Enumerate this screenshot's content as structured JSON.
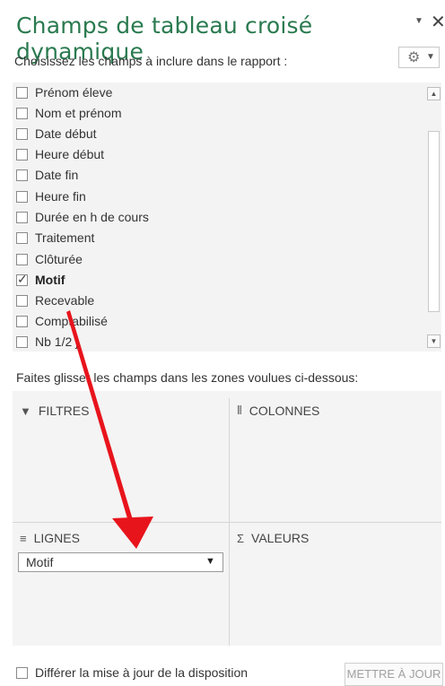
{
  "pane": {
    "title": "Champs de tableau croisé dynamique",
    "menu_icon": "chevron-down-icon",
    "close_icon": "close-icon",
    "subtitle": "Choisissez les champs à inclure dans le rapport :",
    "gear_icon": "gear-icon"
  },
  "fields": [
    {
      "label": "Prénom éleve",
      "checked": false
    },
    {
      "label": "Nom et prénom",
      "checked": false
    },
    {
      "label": "Date début",
      "checked": false
    },
    {
      "label": "Heure début",
      "checked": false
    },
    {
      "label": "Date fin",
      "checked": false
    },
    {
      "label": "Heure fin",
      "checked": false
    },
    {
      "label": "Durée en h de cours",
      "checked": false
    },
    {
      "label": "Traitement",
      "checked": false
    },
    {
      "label": "Clôturée",
      "checked": false
    },
    {
      "label": "Motif",
      "checked": true
    },
    {
      "label": "Recevable",
      "checked": false
    },
    {
      "label": "Comptabilisé",
      "checked": false
    },
    {
      "label": "Nb 1/2 j",
      "checked": false
    }
  ],
  "drag_hint": "Faites glisser les champs dans les zones voulues ci-dessous:",
  "zones": {
    "filters": "FILTRES",
    "columns": "COLONNES",
    "rows": "LIGNES",
    "values": "VALEURS",
    "rows_item": "Motif"
  },
  "footer": {
    "defer_label": "Différer la mise à jour de la disposition",
    "defer_checked": false,
    "update_button": "METTRE À JOUR"
  },
  "colors": {
    "title": "#2a7a4f",
    "annotation_arrow": "#e8141c"
  }
}
